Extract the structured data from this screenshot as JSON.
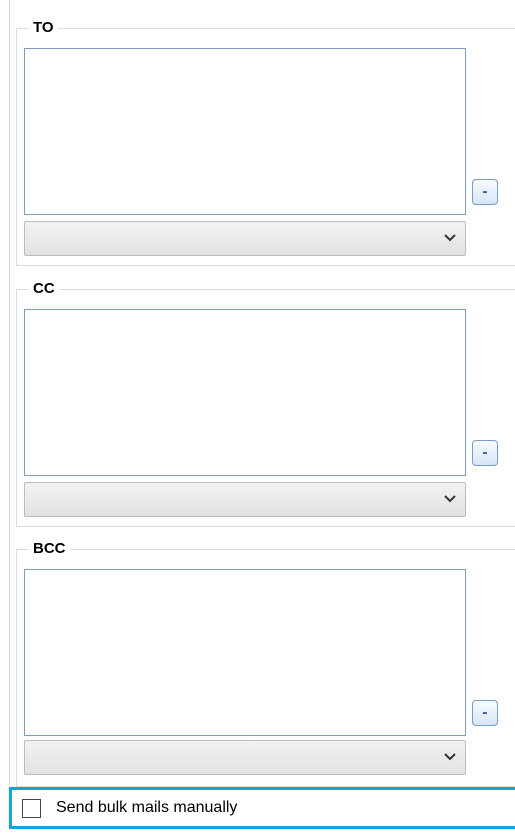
{
  "recipients": {
    "to": {
      "label": "TO",
      "remove_label": "-",
      "selected_value": ""
    },
    "cc": {
      "label": "CC",
      "remove_label": "-",
      "selected_value": ""
    },
    "bcc": {
      "label": "BCC",
      "remove_label": "-",
      "selected_value": ""
    }
  },
  "bulk": {
    "label": "Send bulk mails manually",
    "checked": false
  },
  "colors": {
    "focus_border": "#12a4de",
    "list_border": "#7f9db9",
    "button_border": "#7a9cc8"
  }
}
